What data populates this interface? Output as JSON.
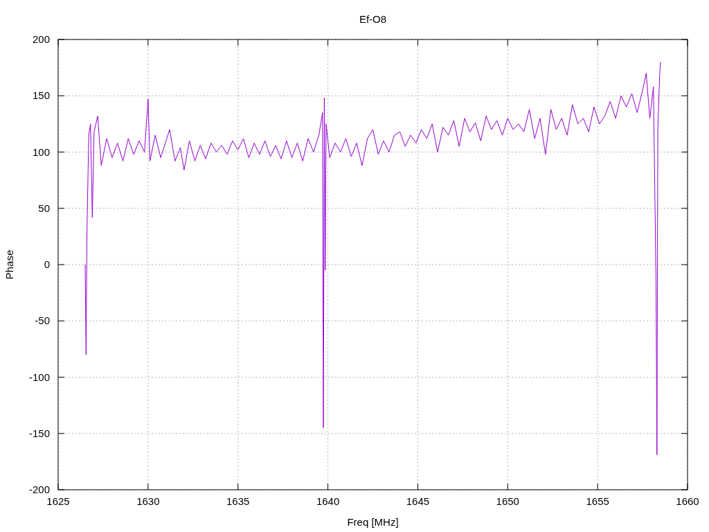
{
  "chart_data": {
    "type": "line",
    "grid": true,
    "title": "Ef-O8",
    "xlabel": "Freq [MHz]",
    "ylabel": "Phase",
    "xlim": [
      1625,
      1660
    ],
    "ylim": [
      -200,
      200
    ],
    "xticks": [
      1625,
      1630,
      1635,
      1640,
      1645,
      1650,
      1655,
      1660
    ],
    "yticks": [
      -200,
      -150,
      -100,
      -50,
      0,
      50,
      100,
      150,
      200
    ],
    "x": [
      1626.5,
      1626.55,
      1626.6,
      1626.7,
      1626.8,
      1626.9,
      1627.0,
      1627.2,
      1627.4,
      1627.7,
      1628.0,
      1628.3,
      1628.6,
      1628.9,
      1629.2,
      1629.5,
      1629.8,
      1630.0,
      1630.1,
      1630.4,
      1630.7,
      1631.0,
      1631.2,
      1631.5,
      1631.8,
      1632.0,
      1632.3,
      1632.6,
      1632.9,
      1633.2,
      1633.5,
      1633.8,
      1634.1,
      1634.4,
      1634.7,
      1635.0,
      1635.3,
      1635.6,
      1635.9,
      1636.2,
      1636.5,
      1636.8,
      1637.1,
      1637.4,
      1637.7,
      1638.0,
      1638.3,
      1638.6,
      1638.9,
      1639.2,
      1639.5,
      1639.7,
      1639.75,
      1639.8,
      1639.85,
      1639.9,
      1640.1,
      1640.4,
      1640.7,
      1641.0,
      1641.3,
      1641.6,
      1641.9,
      1642.2,
      1642.5,
      1642.8,
      1643.1,
      1643.4,
      1643.7,
      1644.0,
      1644.3,
      1644.6,
      1644.9,
      1645.2,
      1645.5,
      1645.8,
      1646.1,
      1646.4,
      1646.7,
      1647.0,
      1647.3,
      1647.6,
      1647.9,
      1648.2,
      1648.5,
      1648.8,
      1649.1,
      1649.4,
      1649.7,
      1650.0,
      1650.3,
      1650.6,
      1650.9,
      1651.2,
      1651.5,
      1651.8,
      1652.1,
      1652.4,
      1652.7,
      1653.0,
      1653.3,
      1653.6,
      1653.9,
      1654.2,
      1654.5,
      1654.8,
      1655.1,
      1655.4,
      1655.7,
      1656.0,
      1656.3,
      1656.6,
      1656.9,
      1657.2,
      1657.5,
      1657.7,
      1657.9,
      1658.1,
      1658.25,
      1658.3,
      1658.35,
      1658.45,
      1658.5
    ],
    "series": [
      {
        "color": "#9400d3",
        "values": [
          0,
          -80,
          30,
          115,
          125,
          42,
          118,
          132,
          88,
          112,
          95,
          108,
          92,
          112,
          98,
          110,
          100,
          147,
          92,
          115,
          95,
          110,
          120,
          92,
          104,
          84,
          110,
          92,
          106,
          94,
          108,
          100,
          106,
          98,
          110,
          102,
          112,
          95,
          108,
          98,
          110,
          96,
          106,
          94,
          110,
          95,
          108,
          92,
          112,
          100,
          115,
          135,
          -145,
          148,
          -5,
          125,
          95,
          108,
          100,
          112,
          96,
          108,
          88,
          112,
          120,
          98,
          110,
          100,
          115,
          118,
          105,
          115,
          108,
          120,
          112,
          125,
          100,
          122,
          115,
          128,
          105,
          130,
          118,
          126,
          110,
          132,
          120,
          128,
          115,
          130,
          120,
          125,
          118,
          138,
          112,
          130,
          98,
          138,
          120,
          130,
          115,
          142,
          125,
          130,
          118,
          140,
          125,
          132,
          145,
          130,
          150,
          140,
          152,
          135,
          155,
          170,
          130,
          158,
          -15,
          -169,
          120,
          168,
          180
        ]
      }
    ]
  }
}
